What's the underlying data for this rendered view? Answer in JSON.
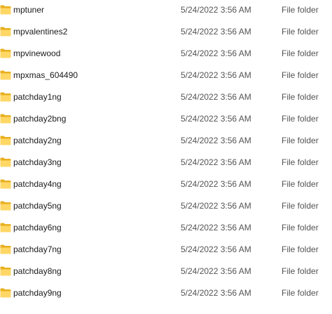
{
  "icons": {
    "folder": "folder-icon",
    "folder_back_color": "#E8B020",
    "folder_front_color": "#FFD765"
  },
  "files": [
    {
      "name": "mptuner",
      "modified": "5/24/2022 3:56 AM",
      "type": "File folder"
    },
    {
      "name": "mpvalentines2",
      "modified": "5/24/2022 3:56 AM",
      "type": "File folder"
    },
    {
      "name": "mpvinewood",
      "modified": "5/24/2022 3:56 AM",
      "type": "File folder"
    },
    {
      "name": "mpxmas_604490",
      "modified": "5/24/2022 3:56 AM",
      "type": "File folder"
    },
    {
      "name": "patchday1ng",
      "modified": "5/24/2022 3:56 AM",
      "type": "File folder"
    },
    {
      "name": "patchday2bng",
      "modified": "5/24/2022 3:56 AM",
      "type": "File folder"
    },
    {
      "name": "patchday2ng",
      "modified": "5/24/2022 3:56 AM",
      "type": "File folder"
    },
    {
      "name": "patchday3ng",
      "modified": "5/24/2022 3:56 AM",
      "type": "File folder"
    },
    {
      "name": "patchday4ng",
      "modified": "5/24/2022 3:56 AM",
      "type": "File folder"
    },
    {
      "name": "patchday5ng",
      "modified": "5/24/2022 3:56 AM",
      "type": "File folder"
    },
    {
      "name": "patchday6ng",
      "modified": "5/24/2022 3:56 AM",
      "type": "File folder"
    },
    {
      "name": "patchday7ng",
      "modified": "5/24/2022 3:56 AM",
      "type": "File folder"
    },
    {
      "name": "patchday8ng",
      "modified": "5/24/2022 3:56 AM",
      "type": "File folder"
    },
    {
      "name": "patchday9ng",
      "modified": "5/24/2022 3:56 AM",
      "type": "File folder"
    }
  ]
}
